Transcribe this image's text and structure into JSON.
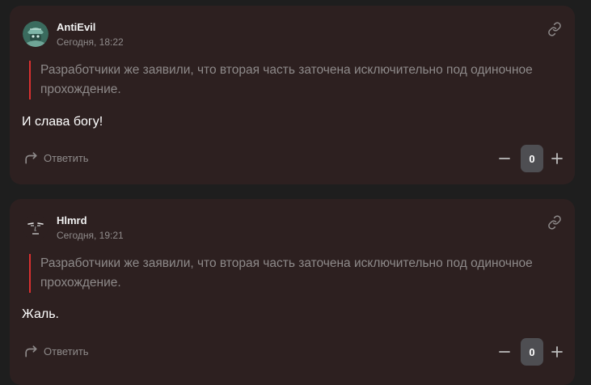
{
  "comments": [
    {
      "author": "AntiEvil",
      "time": "Сегодня, 18:22",
      "quote": "Разработчики же заявили, что вторая часть заточена исключительно под одиночное прохождение.",
      "text": "И слава богу!",
      "reply_label": "Ответить",
      "score": "0",
      "avatar_icon": "helmet-soldier-avatar",
      "link_icon": "link-icon"
    },
    {
      "author": "Hlmrd",
      "time": "Сегодня, 19:21",
      "quote": "Разработчики же заявили, что вторая часть заточена исключительно под одиночное прохождение.",
      "text": "Жаль.",
      "reply_label": "Ответить",
      "score": "0",
      "avatar_icon": "face-sketch-avatar",
      "link_icon": "link-icon"
    }
  ],
  "colors": {
    "page_background": "#1e1e1e",
    "card_background": "#2d2020",
    "quote_bar": "#d93030",
    "muted_text": "#8e8a8a",
    "score_background": "#4e4e52"
  }
}
